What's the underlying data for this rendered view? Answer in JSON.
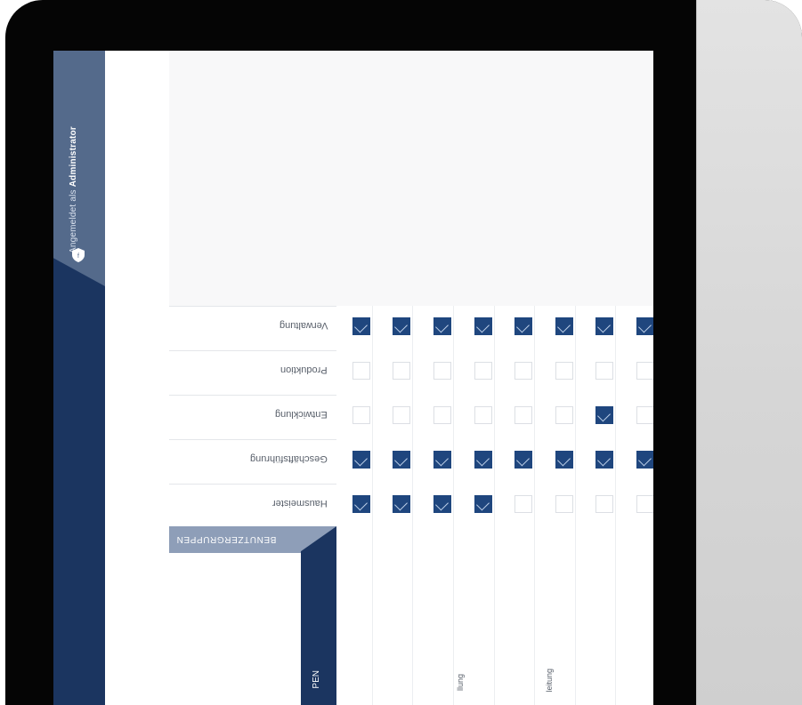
{
  "header": {
    "logged_in_prefix": "Angemeldet als",
    "logged_in_user": "Administrator"
  },
  "matrix": {
    "rows": [
      {
        "label": "Verwaltung",
        "cells": [
          true,
          true,
          true,
          true,
          true,
          true,
          true,
          true
        ]
      },
      {
        "label": "Produktion",
        "cells": [
          false,
          false,
          false,
          false,
          false,
          false,
          false,
          false
        ]
      },
      {
        "label": "Entwicklung",
        "cells": [
          false,
          false,
          false,
          false,
          false,
          false,
          true,
          false
        ]
      },
      {
        "label": "Geschäftsführung",
        "cells": [
          true,
          true,
          true,
          true,
          true,
          true,
          true,
          true
        ]
      },
      {
        "label": "Hausmeister",
        "cells": [
          true,
          true,
          true,
          true,
          false,
          false,
          false,
          false
        ]
      }
    ],
    "group_header": "BENUTZERGRUPPEN",
    "group_side_label": "PEN",
    "bottom_labels": [
      "llung",
      "leitung"
    ]
  },
  "colors": {
    "checked": "#1f467e",
    "sidebar": "#1b3560",
    "sidebar_top": "#546a8b"
  },
  "icons": {
    "logo": "shield-icon"
  }
}
